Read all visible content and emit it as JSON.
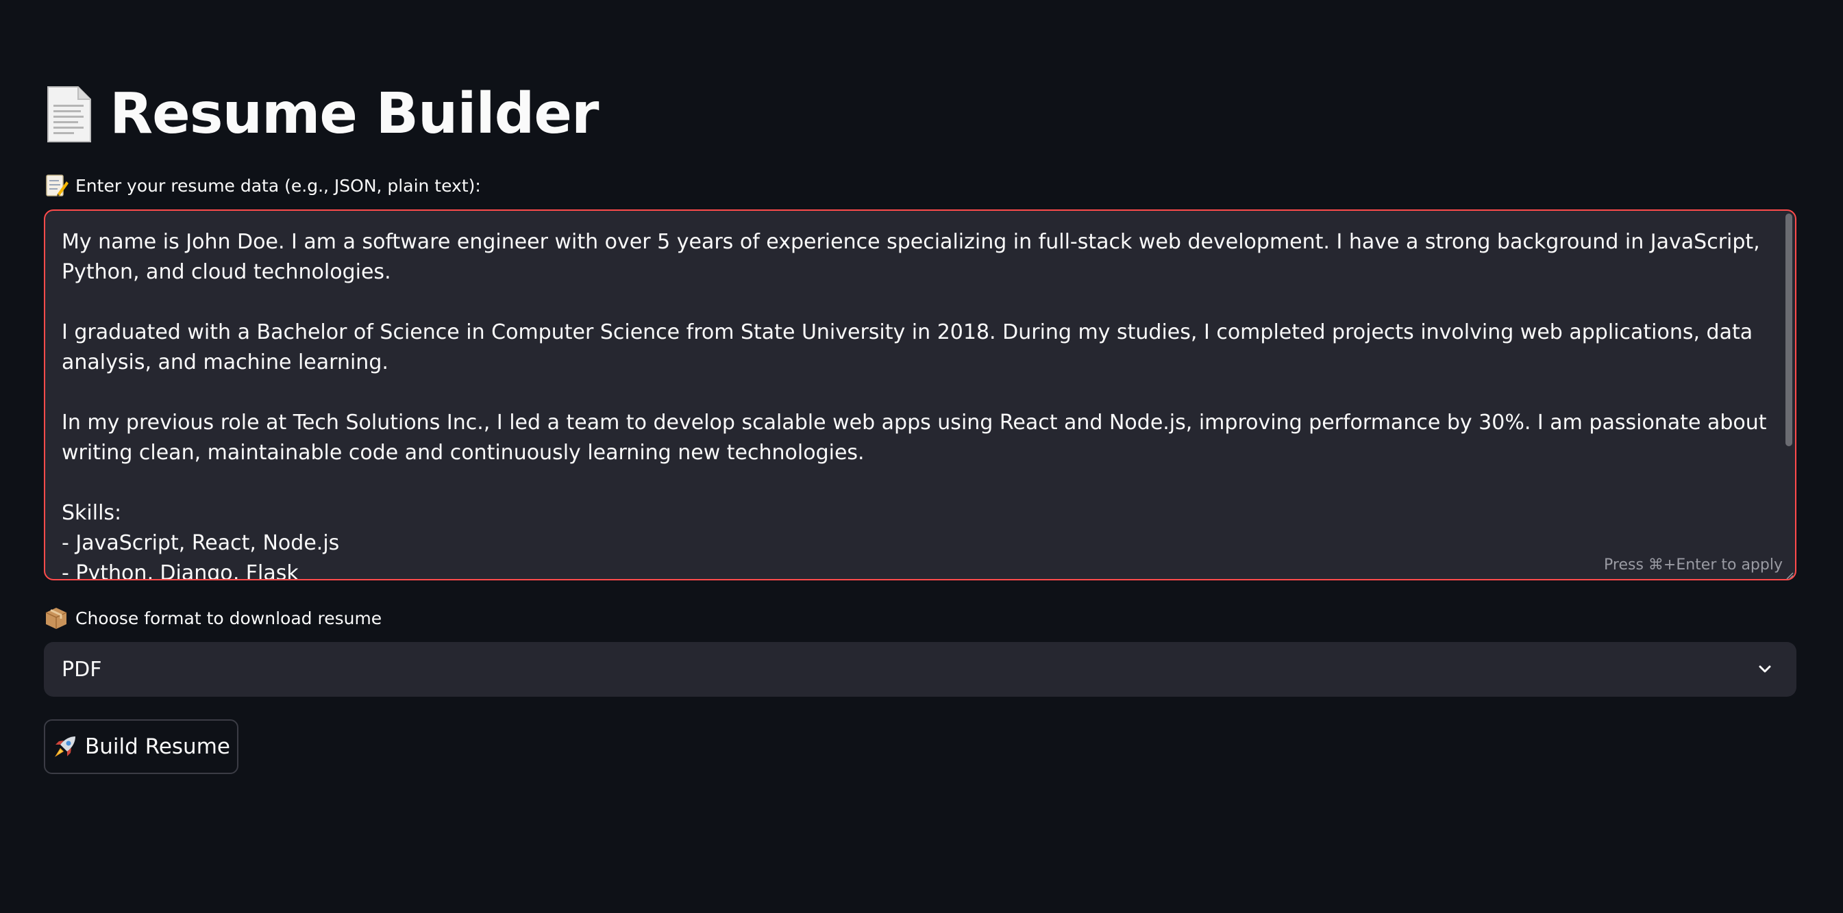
{
  "header": {
    "title": "Resume Builder",
    "icon": "page-facing-up-icon"
  },
  "resume_input": {
    "label": "Enter your resume data (e.g., JSON, plain text):",
    "label_icon": "memo-icon",
    "value": "My name is John Doe. I am a software engineer with over 5 years of experience specializing in full-stack web development. I have a strong background in JavaScript, Python, and cloud technologies.\n\nI graduated with a Bachelor of Science in Computer Science from State University in 2018. During my studies, I completed projects involving web applications, data analysis, and machine learning.\n\nIn my previous role at Tech Solutions Inc., I led a team to develop scalable web apps using React and Node.js, improving performance by 30%. I am passionate about writing clean, maintainable code and continuously learning new technologies.\n\nSkills:\n- JavaScript, React, Node.js\n- Python, Django, Flask",
    "hint": "Press ⌘+Enter to apply",
    "border_color": "#ff4b4b"
  },
  "format_select": {
    "label": "Choose format to download resume",
    "label_icon": "package-icon",
    "selected": "PDF"
  },
  "build_button": {
    "label": "Build Resume",
    "icon": "rocket-icon"
  },
  "colors": {
    "background": "#0e1117",
    "input_background": "#262730",
    "text": "#fafafa",
    "accent": "#ff4b4b"
  }
}
